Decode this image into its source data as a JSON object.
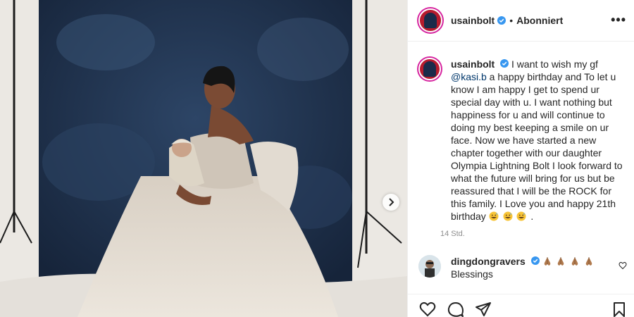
{
  "post": {
    "username": "usainbolt",
    "follow_status": "Abonniert",
    "separator": "•",
    "more": "•••"
  },
  "caption": {
    "username": "usainbolt",
    "intro": " I want to wish my gf ",
    "mention": "@kasi.b",
    "body": " a happy birthday and To let u know I am happy I get to spend ur special day with u. I want nothing but happiness for u and will continue to doing my best keeping a smile on ur face. Now we have started a new chapter together with our daughter Olympia Lightning Bolt I look forward to what the future will bring for us but be reassured that I will be the ROCK for this family. I Love you and happy 21th birthday",
    "ending": "."
  },
  "timestamp": "14 Std.",
  "comment": {
    "username": "dingdongravers",
    "text": "Blessings"
  },
  "icons": {
    "verified": "verified-badge-icon",
    "emoji_caption": "grinning-sweat-emoji",
    "emoji_comment": "folded-hands-emoji",
    "carousel": "chevron-right-icon",
    "like": "heart-icon",
    "comment": "comment-icon",
    "share": "share-icon",
    "save": "bookmark-icon"
  },
  "colors": {
    "text": "#262626",
    "muted": "#8e8e8e",
    "link": "#00376b",
    "verified": "#3897f0",
    "border": "#efefef"
  }
}
